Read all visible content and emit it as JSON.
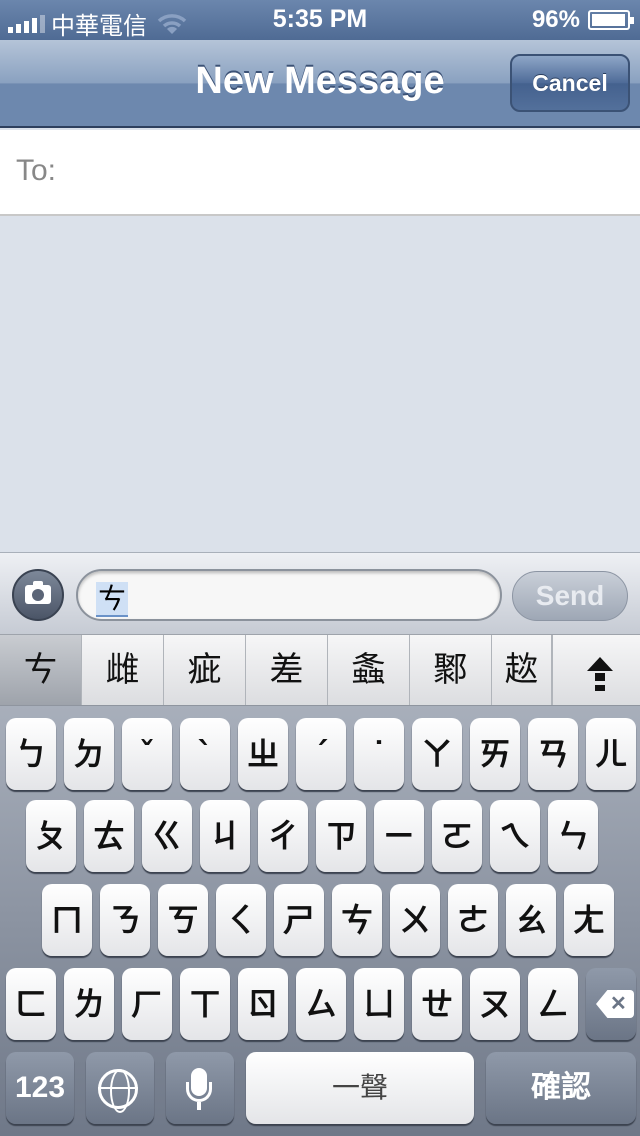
{
  "status_bar": {
    "carrier": "中華電信",
    "time": "5:35 PM",
    "battery": "96%",
    "battery_level": 0.96
  },
  "nav": {
    "title": "New Message",
    "cancel_label": "Cancel"
  },
  "to_field": {
    "label": "To:"
  },
  "compose": {
    "input_value": "ㄘ",
    "send_label": "Send"
  },
  "candidates": [
    "ㄘ",
    "雌",
    "疵",
    "差",
    "螽",
    "鄹",
    "趑"
  ],
  "keyboard": {
    "rows": [
      [
        "ㄅ",
        "ㄉ",
        "ˇ",
        "ˋ",
        "ㄓ",
        "ˊ",
        "˙",
        "ㄚ",
        "ㄞ",
        "ㄢ",
        "ㄦ"
      ],
      [
        "ㄆ",
        "ㄊ",
        "ㄍ",
        "ㄐ",
        "ㄔ",
        "ㄗ",
        "ㄧ",
        "ㄛ",
        "ㄟ",
        "ㄣ"
      ],
      [
        "ㄇ",
        "ㄋ",
        "ㄎ",
        "ㄑ",
        "ㄕ",
        "ㄘ",
        "ㄨ",
        "ㄜ",
        "ㄠ",
        "ㄤ"
      ],
      [
        "ㄈ",
        "ㄌ",
        "ㄏ",
        "ㄒ",
        "ㄖ",
        "ㄙ",
        "ㄩ",
        "ㄝ",
        "ㄡ",
        "ㄥ"
      ]
    ],
    "numbers_label": "123",
    "space_label": "一聲",
    "confirm_label": "確認"
  }
}
